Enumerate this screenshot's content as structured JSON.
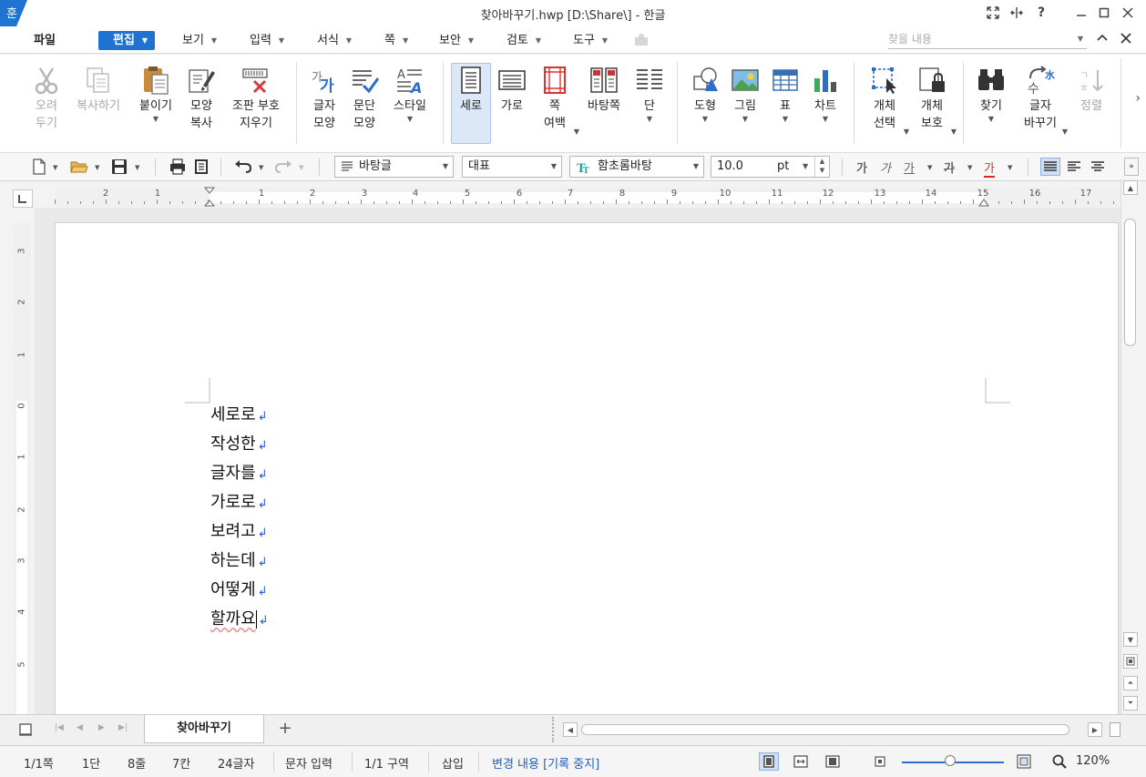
{
  "window": {
    "title": "찾아바꾸기.hwp [D:\\Share\\] - 한글",
    "app_logo_glyph": "훈"
  },
  "menu": {
    "file": "파일",
    "items": [
      {
        "label": "편집",
        "active": true
      },
      {
        "label": "보기"
      },
      {
        "label": "입력"
      },
      {
        "label": "서식"
      },
      {
        "label": "쪽"
      },
      {
        "label": "보안"
      },
      {
        "label": "검토"
      },
      {
        "label": "도구"
      }
    ],
    "find_placeholder": "찾을 내용"
  },
  "ribbon": {
    "cut": "오려\n두기",
    "copy": "복사하기",
    "paste": "붙이기",
    "format_copy": "모양\n복사",
    "remove_codes": "조판 부호\n지우기",
    "char_shape": "글자\n모양",
    "para_shape": "문단\n모양",
    "style": "스타일",
    "portrait": "세로",
    "landscape": "가로",
    "page_margin": "쪽\n여백",
    "master_page": "바탕쪽",
    "columns": "단",
    "shape": "도형",
    "picture": "그림",
    "table": "표",
    "chart": "차트",
    "object_select": "개체\n선택",
    "object_protect": "개체\n보호",
    "find": "찾기",
    "replace_chars": "글자\n바꾸기",
    "sort": "정렬"
  },
  "format_toolbar": {
    "style": "바탕글",
    "lang": "대표",
    "font": "함초롬바탕",
    "font_size": "10.0",
    "unit": "pt",
    "bold_glyph": "가",
    "italic_glyph": "가",
    "underline_glyph": "가",
    "strike_glyph": "가",
    "color_glyph": "가"
  },
  "ruler": {
    "h_labels": [
      "2",
      "1",
      "1",
      "2",
      "3",
      "4",
      "5",
      "6",
      "7",
      "8",
      "9",
      "10",
      "11",
      "12",
      "13",
      "14",
      "15",
      "16",
      "17"
    ],
    "v_labels": [
      "3",
      "2",
      "1",
      "0",
      "1",
      "2",
      "3",
      "4",
      "5"
    ]
  },
  "document": {
    "lines": [
      "세로로",
      "작성한",
      "글자를",
      "가로로",
      "보려고",
      "하는데",
      "어떻게",
      "할까요"
    ],
    "para_mark": "↲"
  },
  "tabs": {
    "active": "찾아바꾸기",
    "add": "+"
  },
  "status": {
    "page": "1/1쪽",
    "column": "1단",
    "line": "8줄",
    "col": "7칸",
    "chars": "24글자",
    "mode": "문자 입력",
    "section": "1/1 구역",
    "insert": "삽입",
    "track": "변경 내용 [기록 중지]",
    "zoom": "120%",
    "zoom_level": 0.47
  },
  "colors": {
    "accent": "#1e73d2",
    "para_mark": "#2a5bd7",
    "status_blue": "#1f5fc7"
  }
}
